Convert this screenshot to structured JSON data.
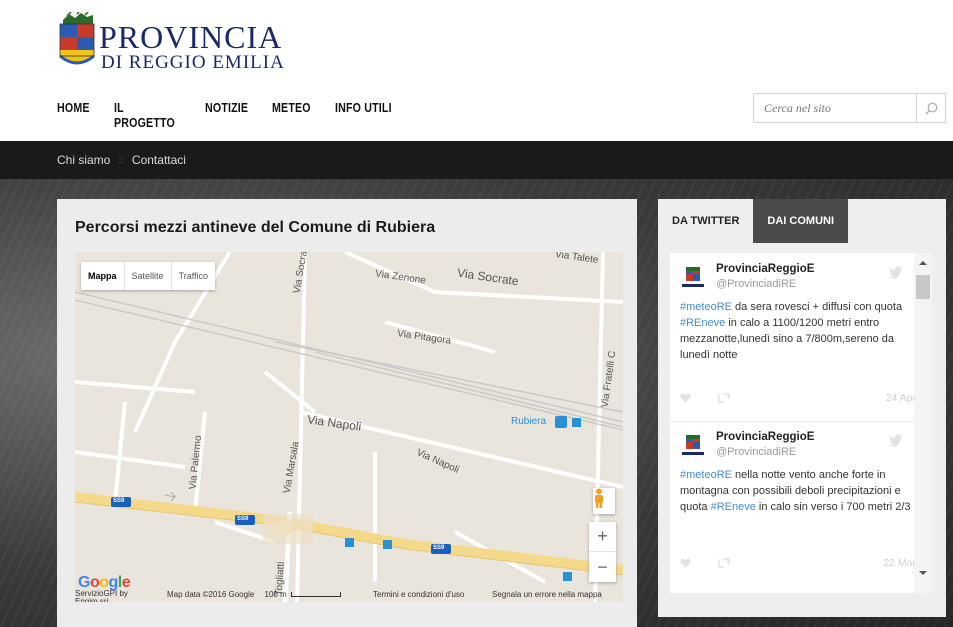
{
  "brand": {
    "title": "PROVINCIA",
    "subtitle": "DI REGGIO EMILIA"
  },
  "nav": {
    "items": [
      "HOME",
      "IL PROGETTO",
      "NOTIZIE",
      "METEO",
      "INFO UTILI"
    ]
  },
  "search": {
    "placeholder": "Cerca nel sito"
  },
  "subnav": {
    "items": [
      "Chi siamo",
      "Contattaci"
    ],
    "separator": "::"
  },
  "content": {
    "title": "Percorsi mezzi antineve del Comune di Rubiera"
  },
  "map": {
    "types": [
      "Mappa",
      "Satellite",
      "Traffico"
    ],
    "streets": {
      "talete": "Via Talete",
      "zenone": "Via Zenone",
      "socrate_h": "Via Socrate",
      "socrate_v": "Via Socrate",
      "pitagora": "Via Pitagora",
      "fratelli": "Via Fratelli C",
      "napoli1": "Via Napoli",
      "napoli2": "Via Napoli",
      "palermo": "Via Palermo",
      "marsala": "Via Marsala",
      "togliatti": "Togliatti"
    },
    "station": "Rubiera",
    "road_labels": [
      "SS9",
      "SS9",
      "SS9"
    ],
    "zoom_in": "+",
    "zoom_out": "−",
    "google": "Google",
    "servizio": "ServizioGPI by Engim sri",
    "map_data": "Map data ©2016 Google",
    "scale": "100 m",
    "terms": "Termini e condizioni d'uso",
    "report": "Segnala un errore nella mappa"
  },
  "sidebar": {
    "tabs": [
      "DA TWITTER",
      "DAI COMUNI"
    ],
    "tweets": [
      {
        "name": "ProvinciaReggioE",
        "handle": "@ProvinciadiRE",
        "segments": [
          {
            "text": "#meteoRE",
            "tag": true
          },
          {
            "text": " da sera rovesci + diffusi con quota ",
            "tag": false
          },
          {
            "text": "#REneve",
            "tag": true
          },
          {
            "text": " in calo a 1100/1200 metri entro mezzanotte,lunedì sino a 7/800m,sereno da lunedì notte",
            "tag": false
          }
        ],
        "date": "24 Apr"
      },
      {
        "name": "ProvinciaReggioE",
        "handle": "@ProvinciadiRE",
        "segments": [
          {
            "text": "#meteoRE",
            "tag": true
          },
          {
            "text": "  nella notte vento anche forte in montagna con possibili deboli precipitazioni e quota ",
            "tag": false
          },
          {
            "text": "#REneve",
            "tag": true
          },
          {
            "text": " in calo sin verso i 700 metri 2/3",
            "tag": false
          }
        ],
        "date": "22 Mar"
      }
    ]
  },
  "colors": {
    "brand_blue": "#1b2a67",
    "dark_bar": "#1a1a1a",
    "hashtag": "#4a8bc5",
    "tab_active": "#4a4a4a",
    "road_yellow": "#f4d98a",
    "transit_blue": "#2b8fd6"
  }
}
